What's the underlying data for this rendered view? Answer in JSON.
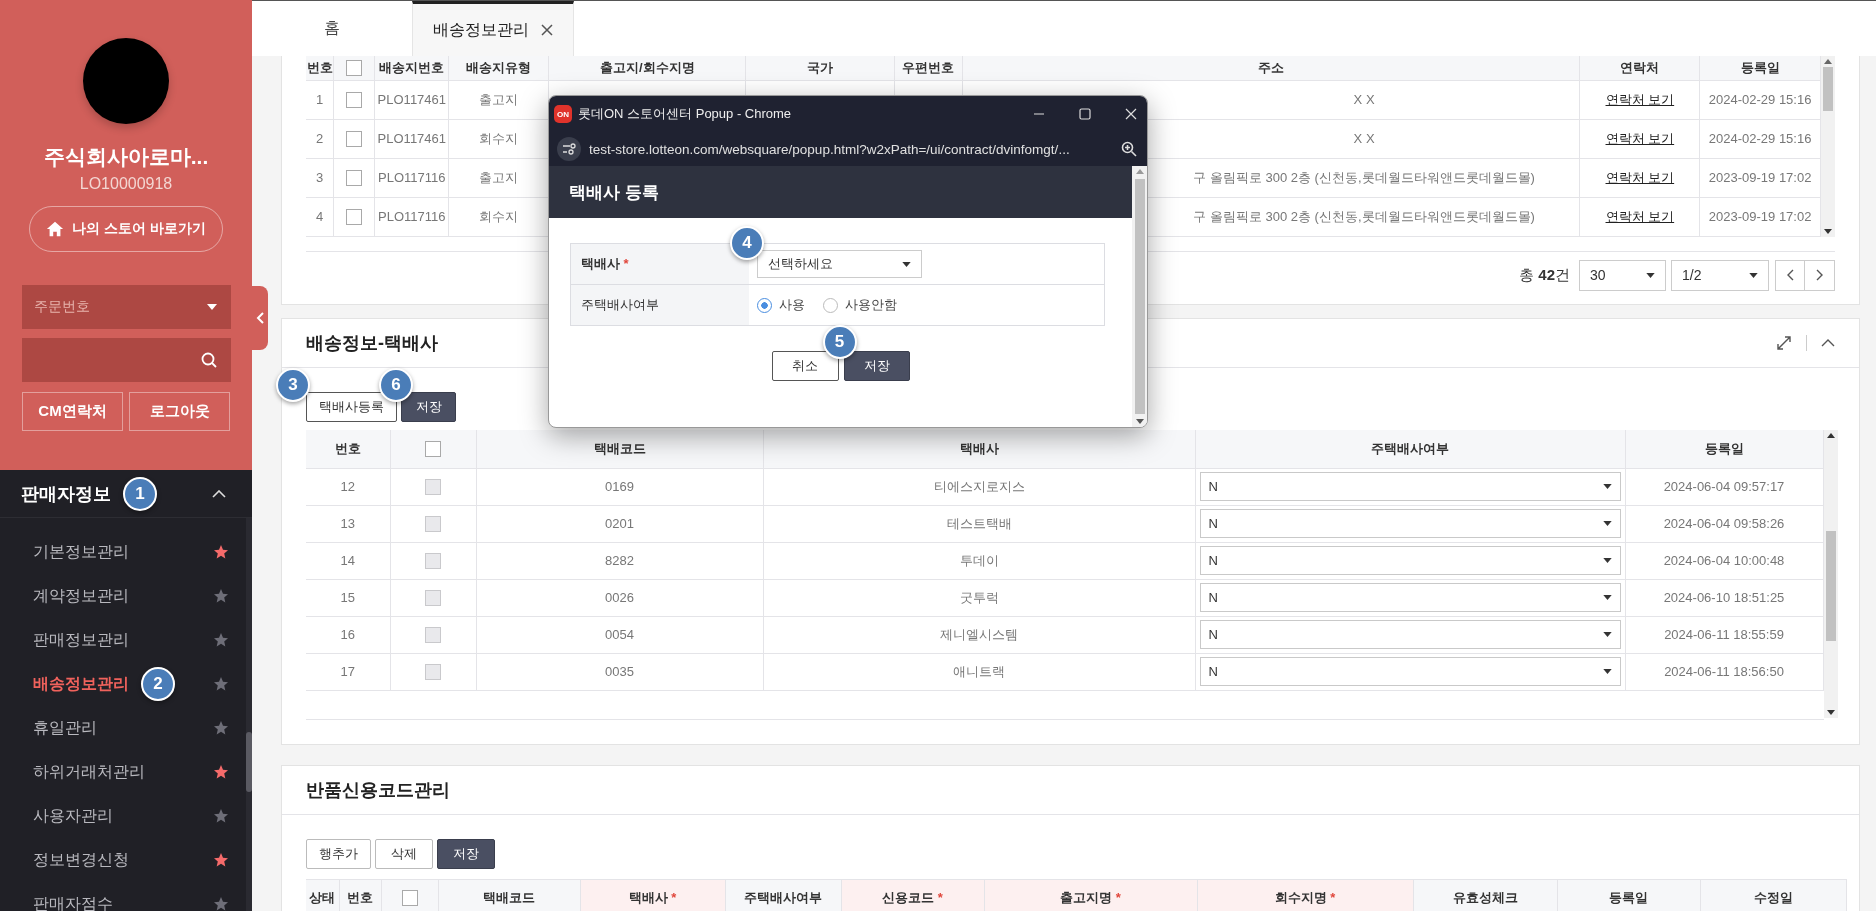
{
  "sidebar": {
    "company_name": "주식회사아로마...",
    "seller_id": "LO10000918",
    "store_button": "나의 스토어 바로가기",
    "search_type": "주문번호",
    "buttons": [
      "CM연락처",
      "로그아웃"
    ],
    "menu": {
      "title": "판매자정보",
      "expanded": true,
      "marker": "1",
      "items": [
        {
          "label": "기본정보관리",
          "selected": false,
          "favorite": true
        },
        {
          "label": "계약정보관리",
          "selected": false,
          "favorite": false
        },
        {
          "label": "판매정보관리",
          "selected": false,
          "favorite": false
        },
        {
          "label": "배송정보관리",
          "selected": true,
          "favorite": false,
          "marker": "2"
        },
        {
          "label": "휴일관리",
          "selected": false,
          "favorite": false
        },
        {
          "label": "하위거래처관리",
          "selected": false,
          "favorite": true
        },
        {
          "label": "사용자관리",
          "selected": false,
          "favorite": false
        },
        {
          "label": "정보변경신청",
          "selected": false,
          "favorite": true
        },
        {
          "label": "판매자점수",
          "selected": false,
          "favorite": false
        }
      ]
    }
  },
  "tabs": [
    {
      "label": "홈",
      "selected": false,
      "closable": false
    },
    {
      "label": "배송정보관리",
      "selected": true,
      "closable": true
    }
  ],
  "address_table": {
    "columns": [
      {
        "kind": "text",
        "label": "번호"
      },
      {
        "kind": "checkbox",
        "checked": false
      },
      {
        "kind": "text",
        "label": "배송지번호"
      },
      {
        "kind": "text",
        "label": "배송지유형"
      },
      {
        "kind": "text",
        "label": "출고지/회수지명"
      },
      {
        "kind": "text",
        "label": "국가"
      },
      {
        "kind": "text",
        "label": "우편번호"
      },
      {
        "kind": "text",
        "label": "주소"
      },
      {
        "kind": "text",
        "label": "연락처"
      },
      {
        "kind": "text",
        "label": "등록일"
      }
    ],
    "rows": [
      {
        "no": "1",
        "checked": false,
        "site_code": "PLO117461",
        "site_type": "출고지",
        "address": "X X",
        "contact": "연락처 보기",
        "registered": "2024-02-29 15:16"
      },
      {
        "no": "2",
        "checked": false,
        "site_code": "PLO117461",
        "site_type": "회수지",
        "address": "X X",
        "contact": "연락처 보기",
        "registered": "2024-02-29 15:16"
      },
      {
        "no": "3",
        "checked": false,
        "site_code": "PLO117116",
        "site_type": "출고지",
        "address": "구 올림픽로 300 2층 (신천동,롯데월드타워앤드롯데월드몰)",
        "contact": "연락처 보기",
        "registered": "2023-09-19 17:02"
      },
      {
        "no": "4",
        "checked": false,
        "site_code": "PLO117116",
        "site_type": "회수지",
        "address": "구 올림픽로 300 2층 (신천동,롯데월드타워앤드롯데월드몰)",
        "contact": "연락처 보기",
        "registered": "2023-09-19 17:02"
      }
    ],
    "pagination": {
      "total": "총 **42**건",
      "page_size": "30",
      "page": "1/2"
    }
  },
  "courier_section": {
    "title": "배송정보-택배사",
    "buttons": [
      {
        "label": "택배사등록",
        "kind": "outline",
        "marker": "3"
      },
      {
        "label": "저장",
        "kind": "primary",
        "marker": "6"
      }
    ],
    "columns": [
      {
        "kind": "text",
        "label": "번호"
      },
      {
        "kind": "checkbox",
        "checked": false
      },
      {
        "kind": "text",
        "label": "택배코드"
      },
      {
        "kind": "text",
        "label": "택배사"
      },
      {
        "kind": "text",
        "label": "주택배사여부"
      },
      {
        "kind": "text",
        "label": "등록일"
      }
    ],
    "rows": [
      {
        "no": "12",
        "checked": false,
        "disabled": true,
        "code": "0169",
        "courier": "티에스지로지스",
        "main_courier": "N",
        "registered": "2024-06-04 09:57:17"
      },
      {
        "no": "13",
        "checked": false,
        "disabled": true,
        "code": "0201",
        "courier": "테스트택배",
        "main_courier": "N",
        "registered": "2024-06-04 09:58:26"
      },
      {
        "no": "14",
        "checked": false,
        "disabled": true,
        "code": "8282",
        "courier": "투데이",
        "main_courier": "N",
        "registered": "2024-06-04 10:00:48"
      },
      {
        "no": "15",
        "checked": false,
        "disabled": true,
        "code": "0026",
        "courier": "굿투럭",
        "main_courier": "N",
        "registered": "2024-06-10 18:51:25"
      },
      {
        "no": "16",
        "checked": false,
        "disabled": true,
        "code": "0054",
        "courier": "제니엘시스템",
        "main_courier": "N",
        "registered": "2024-06-11 18:55:59"
      },
      {
        "no": "17",
        "checked": false,
        "disabled": true,
        "code": "0035",
        "courier": "애니트랙",
        "main_courier": "N",
        "registered": "2024-06-11 18:56:50"
      }
    ]
  },
  "return_code_section": {
    "title": "반품신용코드관리",
    "buttons": [
      {
        "label": "행추가",
        "kind": "outline"
      },
      {
        "label": "삭제",
        "kind": "outline"
      },
      {
        "label": "저장",
        "kind": "primary"
      }
    ],
    "columns": [
      {
        "kind": "text",
        "label": "상태"
      },
      {
        "kind": "text",
        "label": "번호"
      },
      {
        "kind": "checkbox",
        "checked": false
      },
      {
        "kind": "text",
        "label": "택배코드"
      },
      {
        "kind": "text",
        "label": "택배사",
        "required_mark": "*"
      },
      {
        "kind": "text",
        "label": "주택배사여부"
      },
      {
        "kind": "text",
        "label": "신용코드",
        "required_mark": "*"
      },
      {
        "kind": "text",
        "label": "출고지명",
        "required_mark": "*"
      },
      {
        "kind": "text",
        "label": "회수지명",
        "required_mark": "*"
      },
      {
        "kind": "text",
        "label": "유효성체크"
      },
      {
        "kind": "text",
        "label": "등록일"
      },
      {
        "kind": "text",
        "label": "수정일"
      }
    ]
  },
  "popup": {
    "logo_text": "ON",
    "title": "롯데ON 스토어센터 Popup - Chrome",
    "url": "test-store.lotteon.com/websquare/popup.html?w2xPath=/ui/contract/dvinfomgt/...",
    "heading": "택배사 등록",
    "fields": [
      {
        "kind": "select",
        "label": "택배사",
        "required_mark": "*",
        "value": "선택하세요",
        "marker": "4"
      },
      {
        "kind": "radio",
        "label": "주택배사여부",
        "options": [
          {
            "label": "사용",
            "selected": true
          },
          {
            "label": "사용안함",
            "selected": false
          }
        ]
      }
    ],
    "buttons": [
      {
        "label": "취소",
        "kind": "outline"
      },
      {
        "label": "저장",
        "kind": "primary",
        "marker": "5"
      }
    ]
  }
}
